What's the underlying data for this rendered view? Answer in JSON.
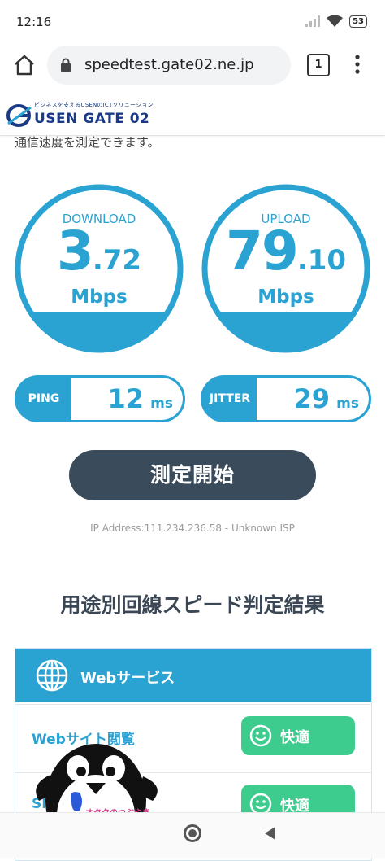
{
  "status": {
    "time": "12:16",
    "battery": "53"
  },
  "browser": {
    "url": "speedtest.gate02.ne.jp",
    "tab_count": "1"
  },
  "site": {
    "logo_tagline": "ビジネスを支えるUSENのICTソリューション",
    "logo_name": "USEN GATE 02"
  },
  "intro": "通信速度を測定できます。",
  "download": {
    "label": "DOWNLOAD",
    "int": "3",
    "dec": ".72",
    "unit": "Mbps"
  },
  "upload": {
    "label": "UPLOAD",
    "int": "79",
    "dec": ".10",
    "unit": "Mbps"
  },
  "ping": {
    "label": "PING",
    "value": "12",
    "unit": "ms"
  },
  "jitter": {
    "label": "JITTER",
    "value": "29",
    "unit": "ms"
  },
  "start_button": "測定開始",
  "ip_info": "IP Address:111.234.236.58 - Unknown ISP",
  "results": {
    "title": "用途別回線スピード判定結果",
    "panel_title": "Webサービス",
    "rows": [
      {
        "label": "Webサイト閲覧",
        "judge": "快適"
      },
      {
        "label": "SNS",
        "judge": "快適"
      }
    ]
  },
  "watermark": "オタクのつぶやき",
  "colors": {
    "accent": "#2aa3d3",
    "button": "#3a4b5c",
    "good": "#3ecb8e"
  }
}
